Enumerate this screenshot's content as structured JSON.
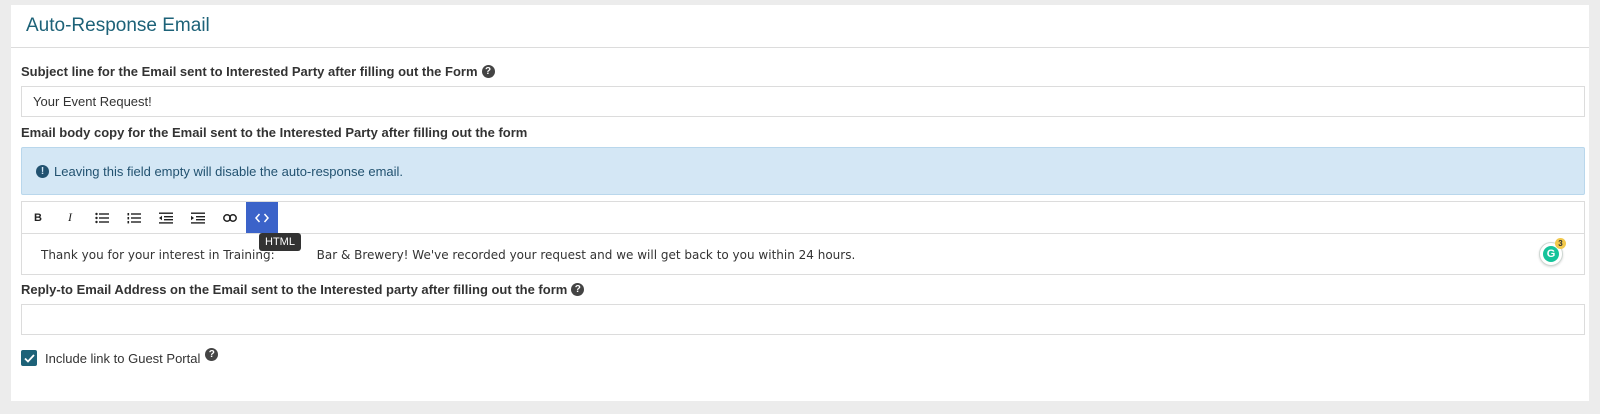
{
  "panel": {
    "title": "Auto-Response Email"
  },
  "subject": {
    "label": "Subject line for the Email sent to Interested Party after filling out the Form",
    "value": "Your Event Request!"
  },
  "body": {
    "label": "Email body copy for the Email sent to the Interested Party after filling out the form",
    "info": "Leaving this field empty will disable the auto-response email.",
    "toolbar": {
      "bold": "B",
      "italic": "I",
      "html_tooltip": "HTML"
    },
    "content": "Thank you for your interest in Training: ",
    "content_hidden": "Bar & Brewery! We've recorded your request and we will get back to you within 24 hours.",
    "grammarly_count": "3"
  },
  "reply_to": {
    "label": "Reply-to Email Address on the Email sent to the Interested party after filling out the form",
    "value": ""
  },
  "guest_portal": {
    "label": "Include link to Guest Portal",
    "checked": true
  },
  "colors": {
    "accent": "#1d6278",
    "info_bg": "#d4e7f5",
    "active_button": "#3b63c9"
  }
}
